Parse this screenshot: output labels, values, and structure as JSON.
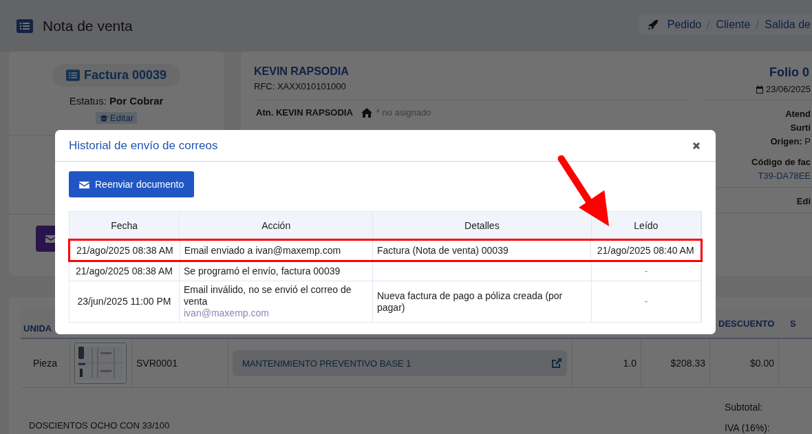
{
  "header": {
    "title": "Nota de venta",
    "breadcrumb": [
      "Pedido",
      "Cliente",
      "Salida de"
    ]
  },
  "summary": {
    "invoice": "Factura 00039",
    "status_label": "Estatus:",
    "status": "Por Cobrar",
    "edit": "Editar"
  },
  "client": {
    "name": "KEVIN RAPSODIA",
    "rfc": "RFC: XAXX010101000",
    "attention": "Atn. KEVIN RAPSODIA",
    "address": "* no asignado"
  },
  "order": {
    "folio": "Folio 0",
    "date": "23/06/2025",
    "attended": "Atend",
    "supplied": "Surti",
    "origin_label": "Origen:",
    "origin": "P",
    "code_label": "Código de fac",
    "code": "T39-DA78EE",
    "edit": "Edi"
  },
  "items": {
    "column_1": "UNIDA",
    "discount_header": "DESCUENTO",
    "column_8": "S",
    "rows": [
      {
        "unit": "Pieza",
        "code": "SVR0001",
        "description": "MANTENIMIENTO PREVENTIVO BASE 1",
        "quantity": "1.0",
        "price": "$208.33",
        "discount": "$0.00"
      }
    ]
  },
  "totals": {
    "amount_words": "DOSCIENTOS OCHO CON 33/100",
    "labels": [
      "Subtotal:",
      "IVA (16%):"
    ]
  },
  "modal": {
    "title": "Historial de envío de correos",
    "resend_button": "Reenviar documento",
    "columns": [
      "Fecha",
      "Acción",
      "Detalles",
      "Leído"
    ],
    "rows": [
      {
        "date": "21/ago/2025 08:38 AM",
        "action": "Email enviado a ivan@maxemp.com",
        "details": "Factura (Nota de venta) 00039",
        "read": "21/ago/2025 08:40 AM",
        "highlighted": true
      },
      {
        "date": "21/ago/2025 08:38 AM",
        "action": "Se programó el envío, factura 00039",
        "read": "-",
        "highlighted": false
      },
      {
        "date": "23/jun/2025 11:00 PM",
        "action": "Email inválido, no se envió el correo de venta",
        "action_email": "ivan@maxemp.com",
        "details": "Nueva factura de pago a póliza creada (por pagar)",
        "read": "-",
        "highlighted": false
      }
    ]
  }
}
